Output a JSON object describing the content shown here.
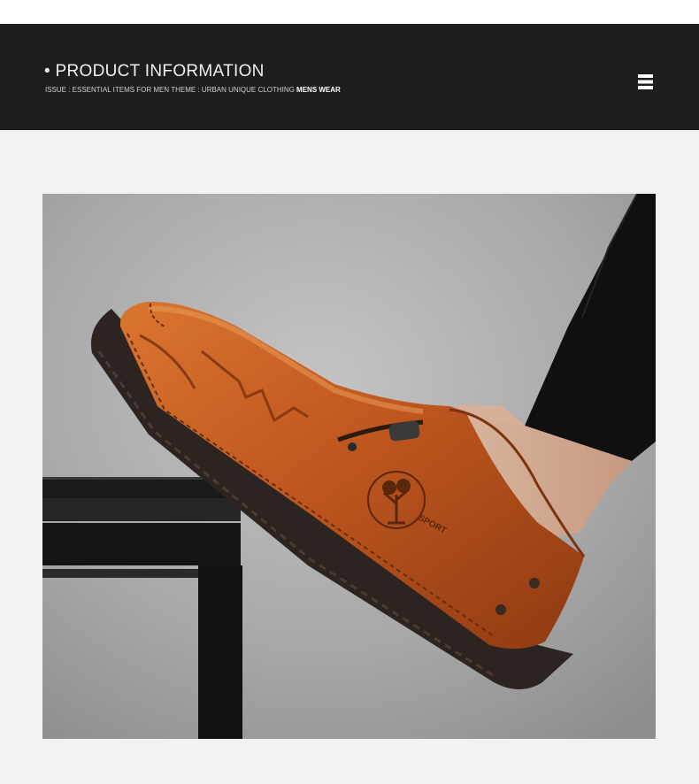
{
  "header": {
    "title": "• PRODUCT INFORMATION",
    "subtitle_prefix": "ISSUE : ESSENTIAL ITEMS FOR MEN  THEME :  URBAN UNIQUE CLOTHING ",
    "subtitle_emphasis": "MENS WEAR",
    "menu_icon": "hamburger-menu-icon"
  },
  "product_image": {
    "logo_text": "SPORT",
    "colors": {
      "leather": "#c0571f",
      "sole": "#2b2420",
      "background": "#a9a9a9",
      "trouser": "#111111"
    }
  },
  "colors": {
    "header_bg": "#1e1e1e",
    "page_bg": "#f2f2f2"
  }
}
